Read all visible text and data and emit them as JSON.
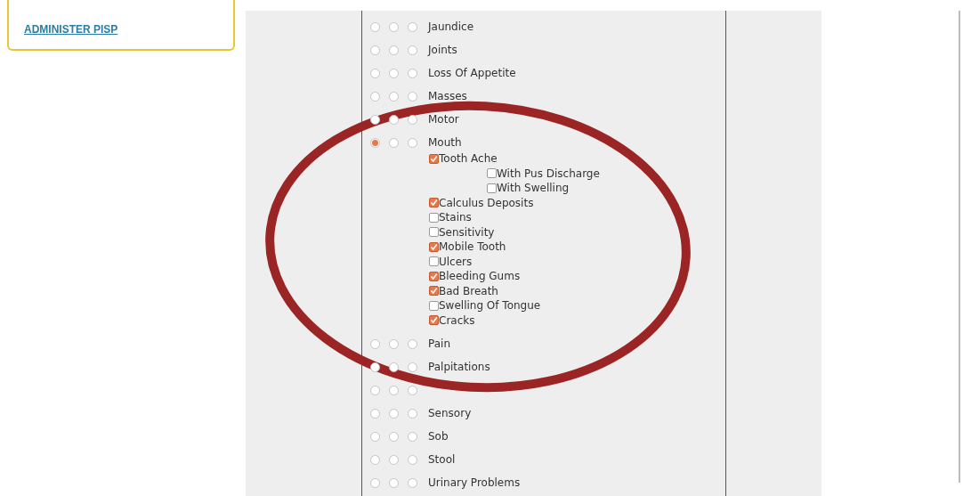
{
  "sidebar_card": {
    "link": "ADMINISTER PISP"
  },
  "symptoms": [
    {
      "label": "Jaundice",
      "options": [
        {
          "selected": false
        },
        {
          "selected": false
        },
        {
          "selected": false
        }
      ]
    },
    {
      "label": "Joints",
      "options": [
        {
          "selected": false
        },
        {
          "selected": false
        },
        {
          "selected": false
        }
      ]
    },
    {
      "label": "Loss Of Appetite",
      "options": [
        {
          "selected": false
        },
        {
          "selected": false
        },
        {
          "selected": false
        }
      ]
    },
    {
      "label": "Masses",
      "options": [
        {
          "selected": false
        },
        {
          "selected": false
        },
        {
          "selected": false
        }
      ]
    },
    {
      "label": "Motor",
      "options": [
        {
          "selected": false
        },
        {
          "selected": false
        },
        {
          "selected": false
        }
      ]
    },
    {
      "label": "Mouth",
      "options": [
        {
          "selected": true
        },
        {
          "selected": false
        },
        {
          "selected": false
        }
      ],
      "children": [
        {
          "label": "Tooth Ache",
          "checked": true,
          "children": [
            {
              "label": "With Pus Discharge",
              "checked": false
            },
            {
              "label": "With Swelling",
              "checked": false
            }
          ]
        },
        {
          "label": "Calculus Deposits",
          "checked": true
        },
        {
          "label": "Stains",
          "checked": false
        },
        {
          "label": "Sensitivity",
          "checked": false
        },
        {
          "label": "Mobile Tooth",
          "checked": true
        },
        {
          "label": "Ulcers",
          "checked": false
        },
        {
          "label": "Bleeding Gums",
          "checked": true
        },
        {
          "label": "Bad Breath",
          "checked": true
        },
        {
          "label": "Swelling Of Tongue",
          "checked": false
        },
        {
          "label": "Cracks",
          "checked": true
        }
      ]
    },
    {
      "label": "Pain",
      "options": [
        {
          "selected": false
        },
        {
          "selected": false
        },
        {
          "selected": false
        }
      ]
    },
    {
      "label": "Palpitations",
      "options": [
        {
          "selected": false
        },
        {
          "selected": false
        },
        {
          "selected": false
        }
      ]
    },
    {
      "options": [
        {
          "selected": false
        },
        {
          "selected": false
        },
        {
          "selected": false
        }
      ]
    },
    {
      "label": "Sensory",
      "options": [
        {
          "selected": false
        },
        {
          "selected": false
        },
        {
          "selected": false
        }
      ]
    },
    {
      "label": "Sob",
      "options": [
        {
          "selected": false
        },
        {
          "selected": false
        },
        {
          "selected": false
        }
      ]
    },
    {
      "label": "Stool",
      "options": [
        {
          "selected": false
        },
        {
          "selected": false
        },
        {
          "selected": false
        }
      ]
    },
    {
      "label": "Urinary Problems",
      "options": [
        {
          "selected": false
        },
        {
          "selected": false
        },
        {
          "selected": false
        }
      ]
    }
  ]
}
